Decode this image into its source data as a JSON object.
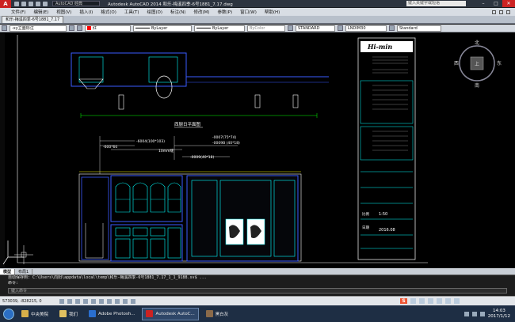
{
  "titlebar": {
    "workspace": "AutoCAD 经典",
    "app_title": "Autodesk AutoCAD 2014    和乐-梅溪四季-6号1881_7.17.dwg",
    "search_placeholder": "键入关键字或短语"
  },
  "menu": {
    "items": [
      "文件(F)",
      "编辑(E)",
      "视图(V)",
      "插入(I)",
      "格式(O)",
      "工具(T)",
      "绘图(D)",
      "标注(N)",
      "修改(M)",
      "参数(P)",
      "窗口(W)",
      "帮助(H)"
    ]
  },
  "doc_tab": {
    "label": "和乐-梅溪四季-6号1881_7.17"
  },
  "toolbar": {
    "dimstyle": "-xy立面标注",
    "color": "红",
    "linetype": "ByLayer",
    "lineweight": "ByLayer",
    "plotstyle": "ByColor",
    "textstyle": "STANDARD",
    "dimension_style": "LNDIM30",
    "table_style": "Standard"
  },
  "viewcube": {
    "north": "北",
    "south": "南",
    "east": "东",
    "west": "西",
    "top": "上"
  },
  "drawing_text": {
    "section_title": "西厨日平面图",
    "brand": "Hi-min",
    "notes": [
      "-6004(100*103)",
      "-600*60",
      "10mm缝",
      "-0007(75*74)",
      "-0009(40*18)",
      "-0009B (40*18)"
    ],
    "title_block": {
      "scale_label": "比例",
      "scale_value": "1:50",
      "date_label": "日期",
      "date_value": "2016.08"
    }
  },
  "layout_tabs": [
    "模型",
    "布局1"
  ],
  "command": {
    "history": "自动保存到: C:\\Users\\向阳\\appdata\\local\\temp\\和乐-梅溪四季-6号1881_7.17_1_1_9188.sv$ ...",
    "prompt": "命令:",
    "placeholder": "键入命令"
  },
  "status": {
    "coords": "573039, -828215, 0"
  },
  "taskbar": {
    "items": [
      {
        "label": "中央美院",
        "color": "#d8b04a"
      },
      {
        "label": "我们",
        "color": "#e0c060"
      },
      {
        "label": "Adobe Photosh...",
        "color": "#2a6fd0"
      },
      {
        "label": "Autodesk AutoC...",
        "color": "#c22"
      },
      {
        "label": "黑白灰",
        "color": "#8a6a4a"
      }
    ],
    "time": "14:03",
    "date": "2017/1/12"
  },
  "colors": {
    "cad_blue": "#3a5bff",
    "cad_cyan": "#00ffff",
    "cad_white": "#ffffff",
    "cad_yellow": "#ffff00",
    "cad_green": "#00ff00"
  }
}
